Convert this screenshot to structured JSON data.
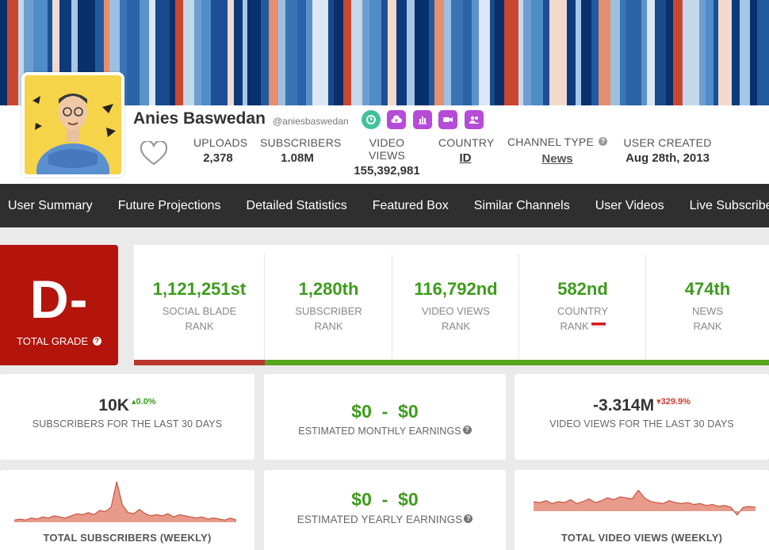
{
  "channel": {
    "name": "Anies Baswedan",
    "handle": "@aniesbaswedan",
    "icons": [
      "socialblade-icon",
      "upload-icon",
      "bar-chart-icon",
      "video-camera-icon",
      "users-icon"
    ]
  },
  "stats": [
    {
      "label": "UPLOADS",
      "value": "2,378"
    },
    {
      "label": "SUBSCRIBERS",
      "value": "1.08M"
    },
    {
      "label": "VIDEO VIEWS",
      "value": "155,392,981"
    },
    {
      "label": "COUNTRY",
      "value": "ID"
    },
    {
      "label": "CHANNEL TYPE",
      "value": "News"
    },
    {
      "label": "USER CREATED",
      "value": "Aug 28th, 2013"
    }
  ],
  "nav": [
    "User Summary",
    "Future Projections",
    "Detailed Statistics",
    "Featured Box",
    "Similar Channels",
    "User Videos",
    "Live Subscribe"
  ],
  "grade": {
    "letter": "D-",
    "label": "TOTAL GRADE"
  },
  "ranks": [
    {
      "value": "1,121,251st",
      "line1": "SOCIAL BLADE",
      "line2": "RANK",
      "bar_color": "#b8362c"
    },
    {
      "value": "1,280th",
      "line1": "SUBSCRIBER",
      "line2": "RANK",
      "bar_color": "#54a51d"
    },
    {
      "value": "116,792nd",
      "line1": "VIDEO VIEWS",
      "line2": "RANK",
      "bar_color": "#54a51d"
    },
    {
      "value": "582nd",
      "line1": "COUNTRY",
      "line2": "RANK",
      "bar_color": "#54a51d"
    },
    {
      "value": "474th",
      "line1": "NEWS",
      "line2": "RANK",
      "bar_color": "#54a51d"
    }
  ],
  "cards": {
    "subs30": {
      "value": "10K",
      "delta": "0.0%",
      "label": "SUBSCRIBERS FOR THE LAST 30 DAYS"
    },
    "monthly": {
      "value": "$0  -  $0",
      "label": "ESTIMATED MONTHLY EARNINGS"
    },
    "views30": {
      "value": "-3.314M",
      "delta": "329.9%",
      "label": "VIDEO VIEWS FOR THE LAST 30 DAYS"
    },
    "subs_weekly": {
      "label": "TOTAL SUBSCRIBERS (WEEKLY)"
    },
    "yearly": {
      "value": "$0  -  $0",
      "label": "ESTIMATED YEARLY EARNINGS"
    },
    "views_weekly": {
      "label": "TOTAL VIDEO VIEWS (WEEKLY)"
    }
  },
  "colors": {
    "accent_green": "#3d9b1c",
    "grade_red": "#b3140c",
    "nav_bg": "#2f2f2f",
    "icon_purple": "#b64bd8",
    "sparkline": "#e07a64"
  },
  "charts": {
    "subs_weekly": [
      2,
      3,
      2,
      4,
      3,
      5,
      4,
      6,
      5,
      4,
      6,
      8,
      7,
      9,
      7,
      11,
      10,
      14,
      38,
      16,
      9,
      8,
      12,
      8,
      6,
      7,
      6,
      8,
      5,
      7,
      6,
      5,
      4,
      5,
      3,
      4,
      3,
      2,
      4,
      2
    ],
    "views_weekly": [
      10,
      9,
      11,
      8,
      10,
      9,
      12,
      8,
      10,
      13,
      9,
      11,
      14,
      12,
      15,
      14,
      13,
      22,
      14,
      10,
      9,
      8,
      11,
      9,
      8,
      9,
      7,
      8,
      6,
      7,
      5,
      6,
      4,
      -4,
      4,
      5,
      4
    ]
  }
}
